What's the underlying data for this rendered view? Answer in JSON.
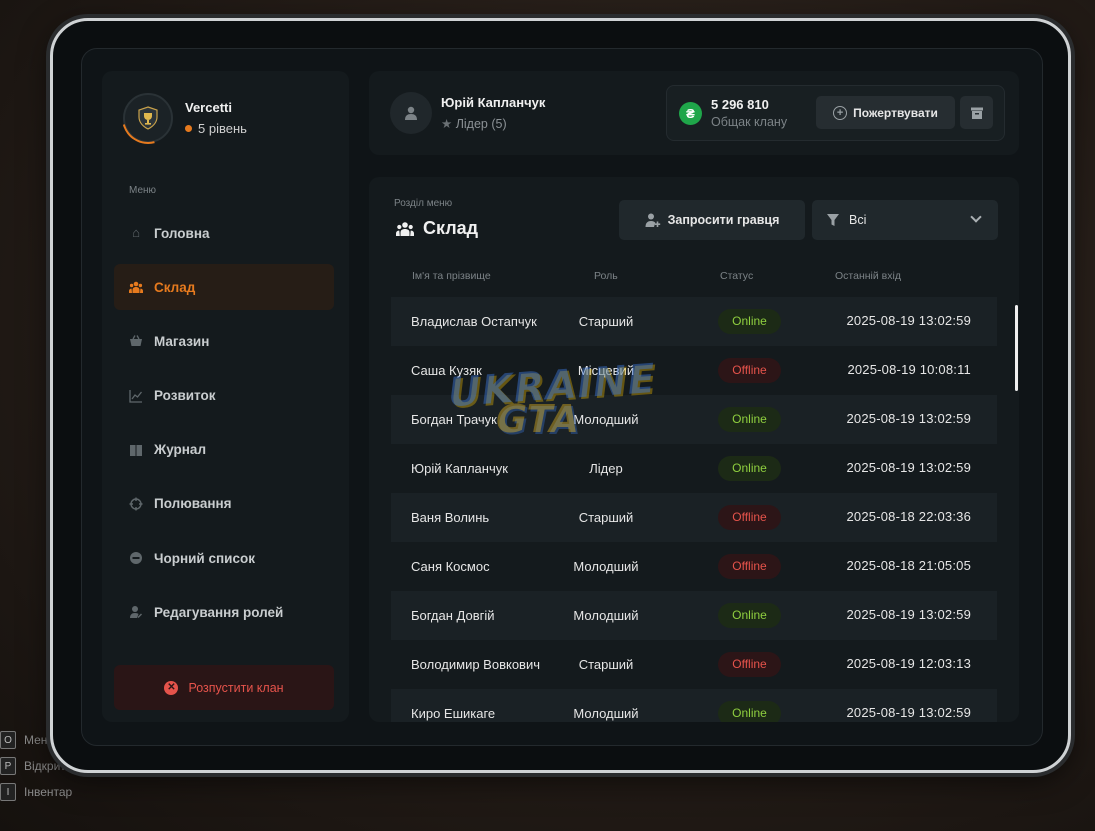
{
  "background_hints": [
    {
      "key": "O",
      "label": "Меню"
    },
    {
      "key": "P",
      "label": "Відкрити телефон"
    },
    {
      "key": "I",
      "label": "Інвентар"
    }
  ],
  "profile": {
    "clan_name": "Vercetti",
    "level": "5 рівень"
  },
  "menu": {
    "heading": "Меню",
    "items": [
      {
        "label": "Головна",
        "icon": "home-icon",
        "active": false
      },
      {
        "label": "Склад",
        "icon": "members-icon",
        "active": true
      },
      {
        "label": "Магазин",
        "icon": "basket-icon",
        "active": false
      },
      {
        "label": "Розвиток",
        "icon": "chart-icon",
        "active": false
      },
      {
        "label": "Журнал",
        "icon": "book-icon",
        "active": false
      },
      {
        "label": "Полювання",
        "icon": "crosshair-icon",
        "active": false
      },
      {
        "label": "Чорний список",
        "icon": "block-icon",
        "active": false
      },
      {
        "label": "Редагування ролей",
        "icon": "user-edit-icon",
        "active": false
      }
    ],
    "disband_label": "Розпустити клан"
  },
  "leader": {
    "name": "Юрій Капланчук",
    "role": "Лідер (5)"
  },
  "treasury": {
    "amount": "5 296 810",
    "label": "Общак клану",
    "donate_label": "Пожертвувати",
    "currency_symbol": "₴"
  },
  "section": {
    "label": "Розділ меню",
    "title": "Склад"
  },
  "invite_label": "Запросити гравця",
  "filter": {
    "selected": "Всі"
  },
  "table": {
    "headers": {
      "name": "Ім'я та прізвище",
      "role": "Роль",
      "status": "Статус",
      "last_login": "Останній вхід"
    },
    "rows": [
      {
        "name": "Владислав Остапчук",
        "role": "Старший",
        "status": "Online",
        "last_login": "2025-08-19 13:02:59"
      },
      {
        "name": "Саша Кузяк",
        "role": "Місцевий",
        "status": "Offline",
        "last_login": "2025-08-19 10:08:11"
      },
      {
        "name": "Богдан Трачук",
        "role": "Молодший",
        "status": "Online",
        "last_login": "2025-08-19 13:02:59"
      },
      {
        "name": "Юрій Капланчук",
        "role": "Лідер",
        "status": "Online",
        "last_login": "2025-08-19 13:02:59"
      },
      {
        "name": "Ваня Волинь",
        "role": "Старший",
        "status": "Offline",
        "last_login": "2025-08-18 22:03:36"
      },
      {
        "name": "Саня Космос",
        "role": "Молодший",
        "status": "Offline",
        "last_login": "2025-08-18 21:05:05"
      },
      {
        "name": "Богдан Довгій",
        "role": "Молодший",
        "status": "Online",
        "last_login": "2025-08-19 13:02:59"
      },
      {
        "name": "Володимир Вовкович",
        "role": "Старший",
        "status": "Offline",
        "last_login": "2025-08-19 12:03:13"
      },
      {
        "name": "Киро Ешикаге",
        "role": "Молодший",
        "status": "Online",
        "last_login": "2025-08-19 13:02:59"
      }
    ]
  },
  "watermark": {
    "line1": "UKRAINE",
    "line2": "GTA"
  },
  "colors": {
    "accent": "#e67a1e",
    "online": "#8fcf3f",
    "offline": "#e5534b",
    "currency": "#1fa64a"
  }
}
